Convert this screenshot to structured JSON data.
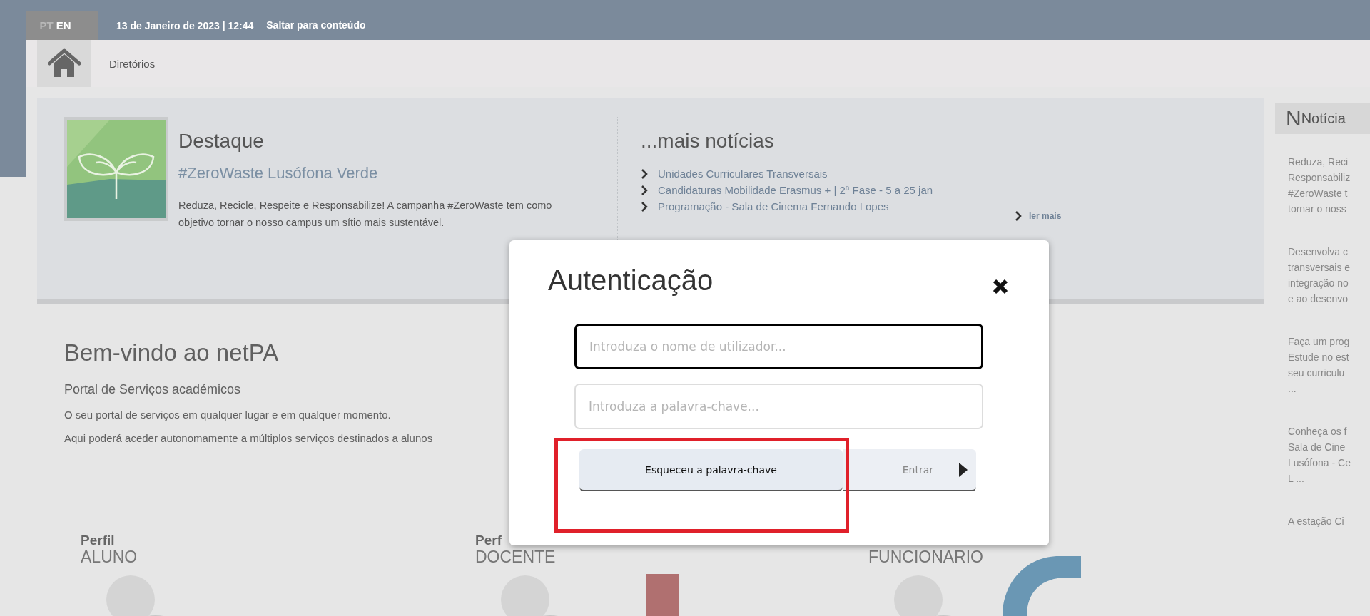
{
  "top_bar": {
    "languages": [
      {
        "code": "PT",
        "selected": false
      },
      {
        "code": "EN",
        "selected": true
      }
    ],
    "datetime": "13 de Janeiro de 2023 | 12:44",
    "skip_link": "Saltar para conteúdo"
  },
  "nav": {
    "items": [
      "Diretórios"
    ]
  },
  "featured": {
    "title": "Destaque",
    "headline": "#ZeroWaste Lusófona Verde",
    "text": "Reduza, Recicle, Respeite e Responsabilize! A campanha #ZeroWaste tem como objetivo tornar o nosso campus um sítio mais sustentável."
  },
  "more_news": {
    "title": "...mais notícias",
    "items": [
      "Unidades Curriculares Transversais",
      "Candidaturas Mobilidade Erasmus + | 2ª Fase - 5 a 25 jan",
      "Programação - Sala de Cinema Fernando Lopes"
    ],
    "read_more": "ler mais"
  },
  "welcome": {
    "title": "Bem-vindo ao netPA",
    "subtitle": "Portal de Serviços académicos",
    "paragraphs": [
      "O seu portal de serviços em qualquer lugar e em qualquer momento.",
      "Aqui poderá aceder autonomamente a múltiplos serviços destinados a alunos"
    ]
  },
  "profiles": [
    {
      "label": "Perfil",
      "role": "ALUNO"
    },
    {
      "label": "Perf",
      "role": "DOCENTE"
    },
    {
      "role": "FUNCIONARIO"
    }
  ],
  "side_news": {
    "initial": "N",
    "title": "Notícia",
    "items": [
      {
        "lines": [
          "Reduza, Reci",
          "Responsabiliz",
          "#ZeroWaste t",
          "tornar o noss"
        ]
      },
      {
        "lines": [
          "Desenvolva c",
          "transversais e",
          "integração no",
          "e ao desenvo"
        ]
      },
      {
        "lines": [
          "Faça um prog",
          "Estude no est",
          "seu curriculu",
          "..."
        ]
      },
      {
        "lines": [
          "Conheça os f",
          "Sala de Cine",
          "Lusófona - Ce",
          "L ..."
        ]
      },
      {
        "lines": [
          "A estação Ci"
        ]
      }
    ]
  },
  "login": {
    "title": "Autenticação",
    "username": {
      "placeholder": "Introduza o nome de utilizador...",
      "focused": true
    },
    "password": {
      "placeholder": "Introduza a palavra-chave...",
      "focused": false
    },
    "forgot_button": "Esqueceu a palavra-chave",
    "submit_button": "Entrar"
  }
}
